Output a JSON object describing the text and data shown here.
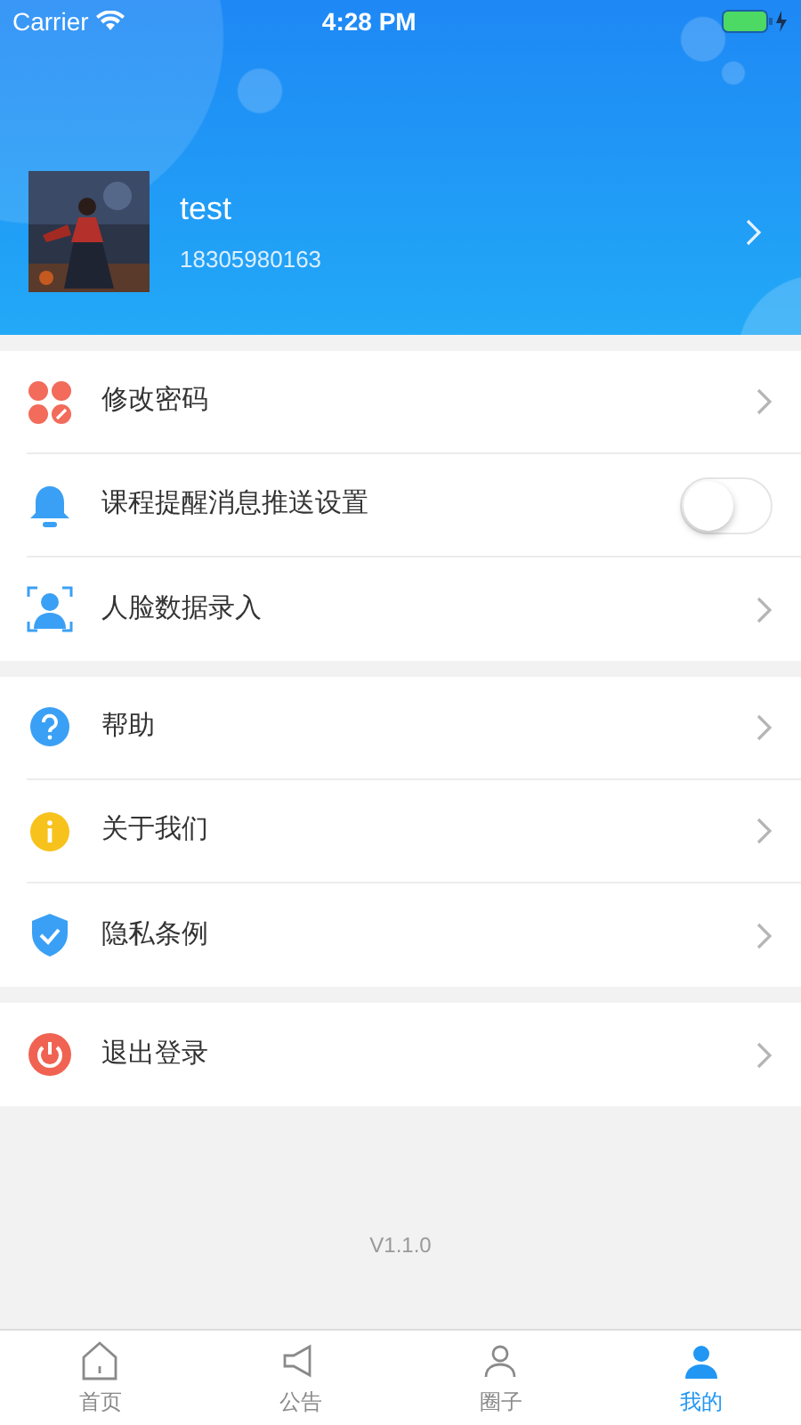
{
  "status_bar": {
    "carrier": "Carrier",
    "time": "4:28 PM"
  },
  "profile": {
    "name": "test",
    "phone": "18305980163"
  },
  "groups": [
    {
      "items": [
        {
          "label": "修改密码",
          "kind": "link"
        },
        {
          "label": "课程提醒消息推送设置",
          "kind": "toggle",
          "on": false
        },
        {
          "label": "人脸数据录入",
          "kind": "link"
        }
      ]
    },
    {
      "items": [
        {
          "label": "帮助",
          "kind": "link"
        },
        {
          "label": "关于我们",
          "kind": "link"
        },
        {
          "label": "隐私条例",
          "kind": "link"
        }
      ]
    },
    {
      "items": [
        {
          "label": "退出登录",
          "kind": "link"
        }
      ]
    }
  ],
  "version": "V1.1.0",
  "tabs": [
    {
      "label": "首页",
      "selected": false
    },
    {
      "label": "公告",
      "selected": false
    },
    {
      "label": "圈子",
      "selected": false
    },
    {
      "label": "我的",
      "selected": true
    }
  ]
}
